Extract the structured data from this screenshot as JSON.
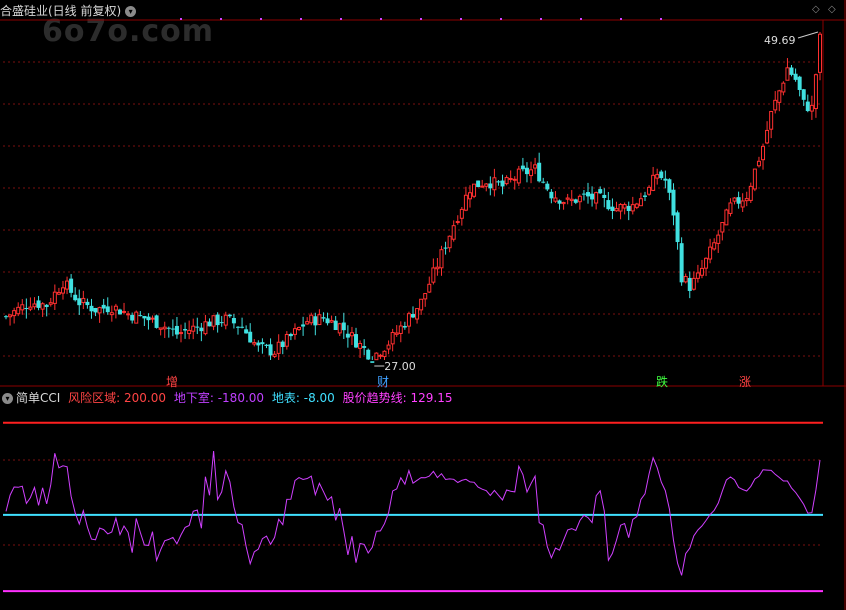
{
  "header": {
    "title": "合盛硅业(日线 前复权)"
  },
  "watermark": "6o7o.com",
  "indicator_header": {
    "name": "简单CCI",
    "items": [
      {
        "label": "风险区域:",
        "value": "200.00",
        "color": "#ff4444"
      },
      {
        "label": "地下室:",
        "value": "-180.00",
        "color": "#c040ff"
      },
      {
        "label": "地表:",
        "value": "-8.00",
        "color": "#40e0ff"
      },
      {
        "label": "股价趋势线:",
        "value": "129.15",
        "color": "#ff40ff"
      }
    ]
  },
  "chart_data": [
    {
      "type": "candlestick",
      "title": "合盛硅业(日线 前复权)",
      "annotations": [
        {
          "text": "49.69",
          "kind": "high_marker"
        },
        {
          "text": "27.00",
          "kind": "low_marker"
        }
      ],
      "signals": [
        {
          "text": "增",
          "color": "#ff4444"
        },
        {
          "text": "财",
          "color": "#40a0ff"
        },
        {
          "text": "跌",
          "color": "#40ff40"
        },
        {
          "text": "涨",
          "color": "#ff4444"
        }
      ],
      "high": 49.69,
      "low": 27.0,
      "colors": {
        "up": "#ff3030",
        "down": "#40e0e0"
      }
    },
    {
      "type": "line",
      "title": "简单CCI",
      "series": [
        {
          "name": "风险区域",
          "value": 200.0,
          "color": "#ff2020"
        },
        {
          "name": "地下室",
          "value": -180.0,
          "color": "#ff30ff"
        },
        {
          "name": "地表",
          "value": -8.0,
          "color": "#40e0ff"
        },
        {
          "name": "股价趋势线",
          "last": 129.15,
          "color": "#d040ff"
        }
      ],
      "ylim": [
        -200,
        240
      ]
    }
  ]
}
